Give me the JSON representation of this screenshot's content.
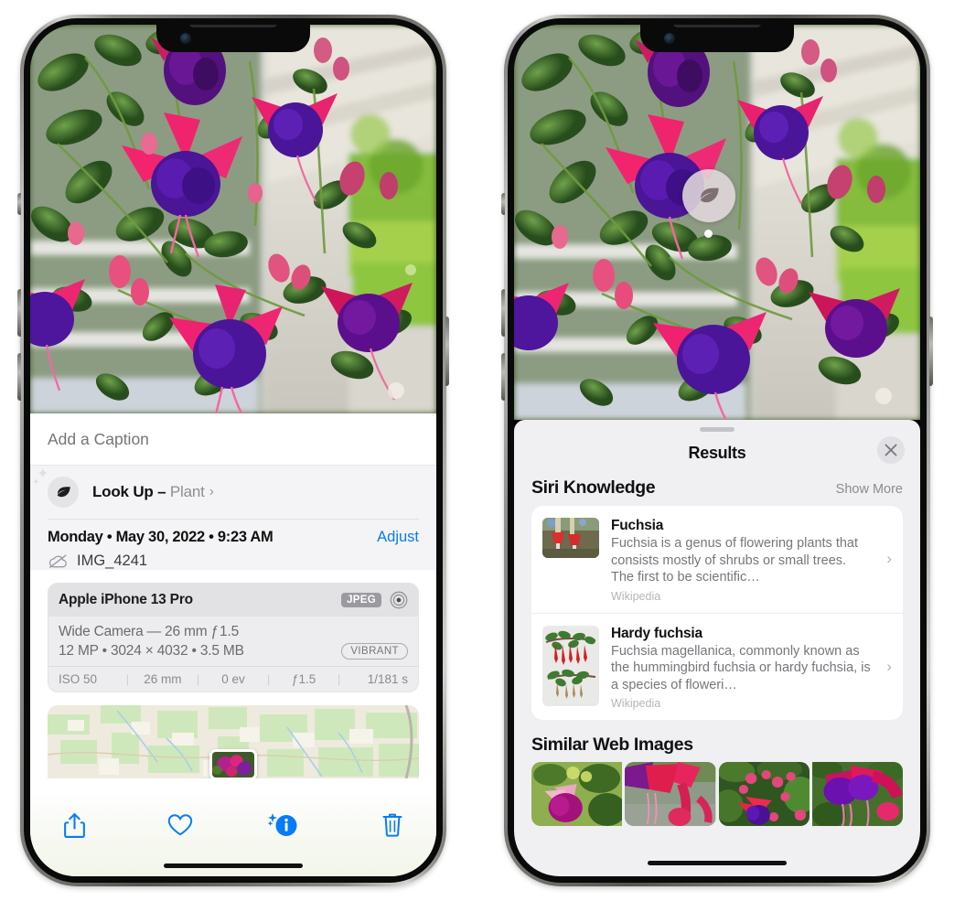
{
  "left_phone": {
    "caption": {
      "placeholder": "Add a Caption",
      "value": ""
    },
    "lookup": {
      "icon": "leaf-icon",
      "label": "Look Up – ",
      "subject": "Plant",
      "chevron": "›"
    },
    "metadata": {
      "date_line": "Monday • May 30, 2022 • 9:23 AM",
      "adjust_label": "Adjust",
      "cloud_icon": "cloud-slash-icon",
      "filename": "IMG_4241"
    },
    "camera_card": {
      "model": "Apple iPhone 13 Pro",
      "format_badge": "JPEG",
      "raw_icon": "aperture-icon",
      "lens_line": "Wide Camera — 26 mm ƒ 1.5",
      "size_line": "12 MP • 3024 × 4032 • 3.5 MB",
      "style_badge": "VIBRANT",
      "exif": [
        "ISO 50",
        "26 mm",
        "0 ev",
        "ƒ1.5",
        "1/181 s"
      ],
      "exif_separator": "|"
    },
    "map": {
      "pin": "photo-pin"
    },
    "toolbar": [
      {
        "name": "share-button",
        "icon": "share-icon"
      },
      {
        "name": "favorite-button",
        "icon": "heart-icon"
      },
      {
        "name": "info-button",
        "icon": "info-sparkle-icon"
      },
      {
        "name": "delete-button",
        "icon": "trash-icon"
      }
    ],
    "accent_color": "#067cf8"
  },
  "right_phone": {
    "marker": {
      "icon": "leaf-icon"
    },
    "sheet": {
      "title": "Results",
      "close_icon": "close-icon",
      "grabber": "drag-handle"
    },
    "siri_knowledge": {
      "heading": "Siri Knowledge",
      "show_more": "Show More",
      "items": [
        {
          "title": "Fuchsia",
          "description": "Fuchsia is a genus of flowering plants that consists mostly of shrubs or small trees. The first to be scientific…",
          "source": "Wikipedia",
          "chevron": "›"
        },
        {
          "title": "Hardy fuchsia",
          "description": "Fuchsia magellanica, commonly known as the hummingbird fuchsia or hardy fuchsia, is a species of floweri…",
          "source": "Wikipedia",
          "chevron": "›"
        }
      ]
    },
    "similar_web_images": {
      "heading": "Similar Web Images",
      "count": 4
    }
  }
}
